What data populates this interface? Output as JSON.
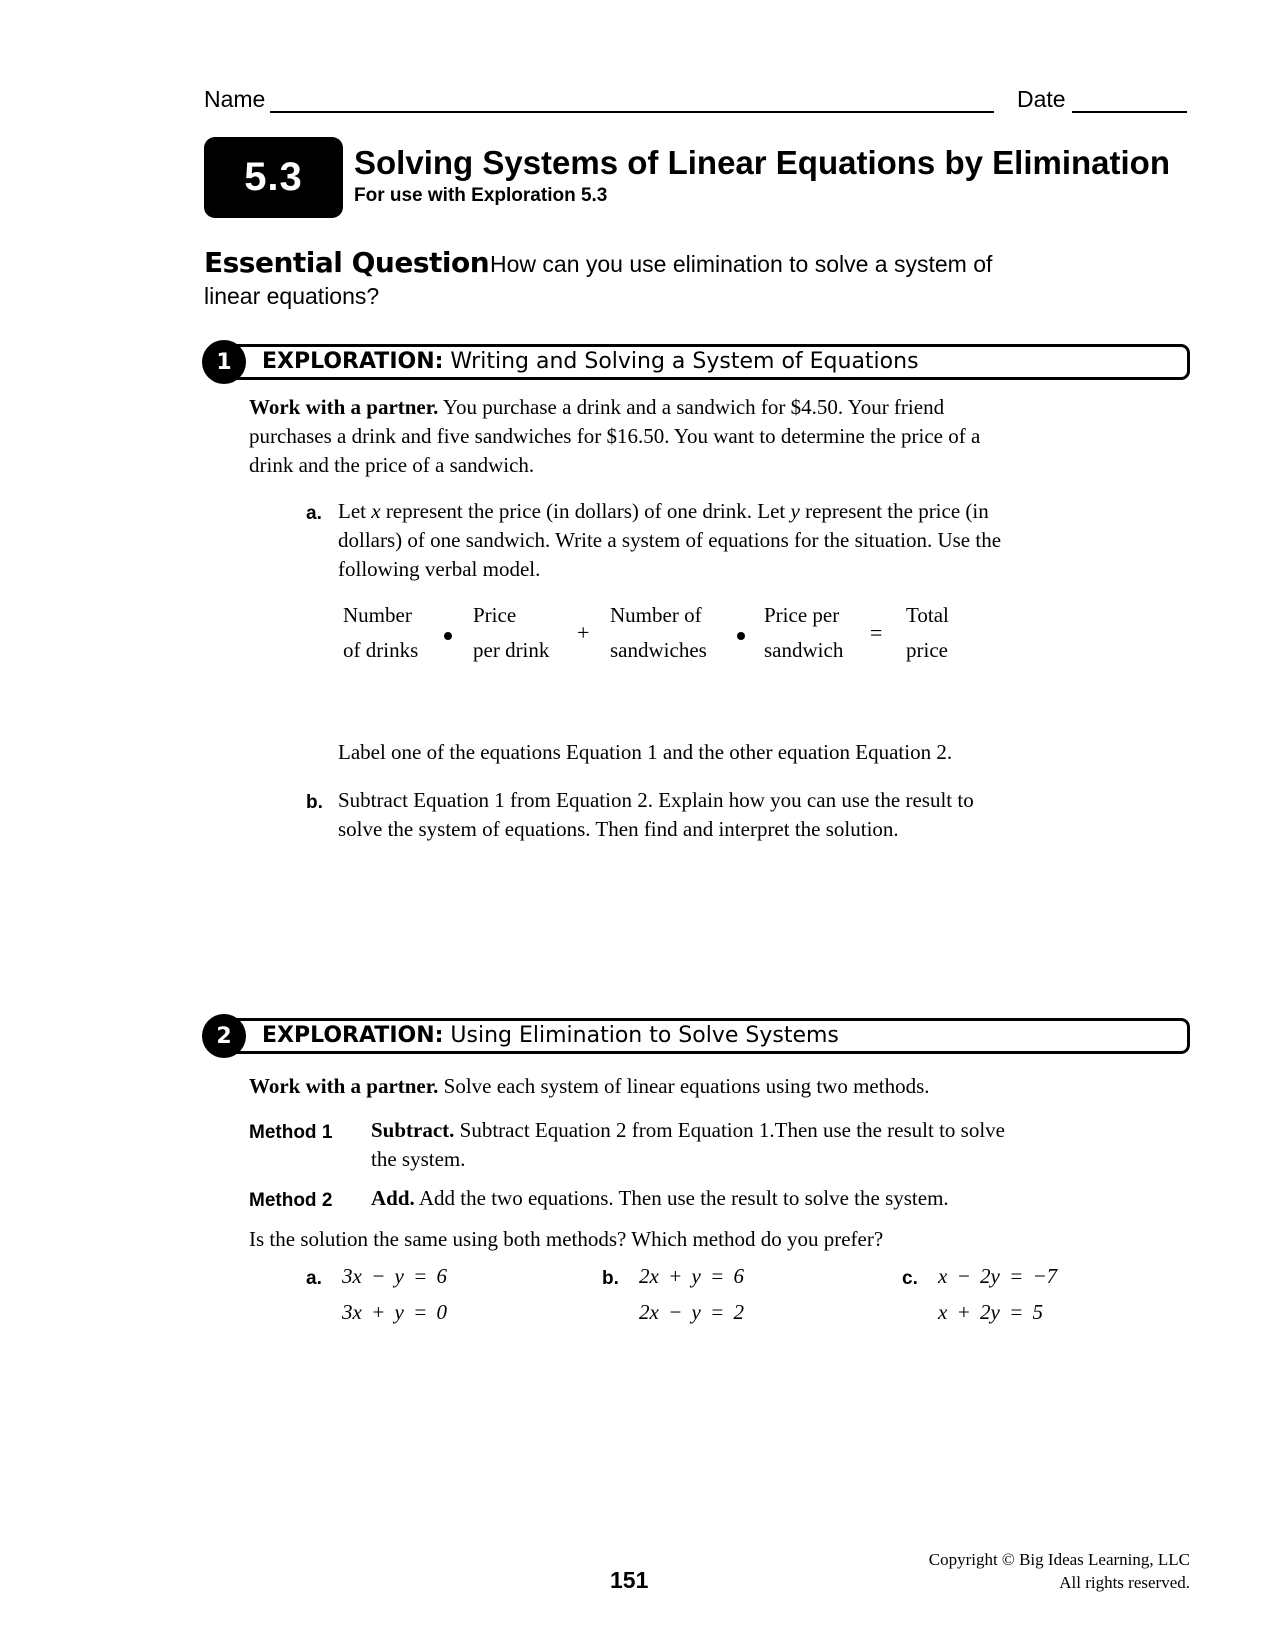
{
  "header": {
    "name_label": "Name",
    "date_label": "Date"
  },
  "lesson": {
    "number": "5.3",
    "title": "Solving Systems of Linear Equations by Elimination",
    "subtitle": "For use with Exploration 5.3"
  },
  "essential_question": {
    "label": "Essential Question",
    "text_line1": "How can you use elimination to solve a system of",
    "text_line2": "linear equations?"
  },
  "exploration1": {
    "number": "1",
    "label": "EXPLORATION:",
    "title": "Writing and Solving a System of Equations",
    "intro_bold": "Work with a partner.",
    "intro_lines": [
      " You purchase a drink and a sandwich for $4.50. Your friend",
      "purchases a drink and five sandwiches for $16.50. You want to determine the price of a",
      "drink and the price of a sandwich."
    ],
    "part_a": {
      "label": "a.",
      "line1_pre": "Let ",
      "var_x": "x",
      "line1_mid": " represent the price (in dollars) of one drink. Let ",
      "var_y": "y",
      "line1_post": " represent the price (in",
      "line2": "dollars) of one sandwich. Write a system of equations for the situation. Use the",
      "line3": "following verbal model."
    },
    "verbal_model": {
      "terms": [
        {
          "top": "Number",
          "bottom": "of drinks"
        },
        {
          "top": "Price",
          "bottom": "per drink"
        },
        {
          "top": "Number of",
          "bottom": "sandwiches"
        },
        {
          "top": "Price per",
          "bottom": "sandwich"
        },
        {
          "top": "Total",
          "bottom": "price"
        }
      ],
      "plus": "+",
      "equals": "="
    },
    "label_instruction": "Label one of the equations Equation 1 and the other equation Equation 2.",
    "part_b": {
      "label": "b.",
      "line1": "Subtract Equation 1 from Equation 2. Explain how you can use the result to",
      "line2": "solve the system of equations. Then find and interpret the solution."
    }
  },
  "exploration2": {
    "number": "2",
    "label": "EXPLORATION:",
    "title": "Using Elimination to Solve Systems",
    "intro_bold": "Work with a partner.",
    "intro_text": " Solve each system of linear equations using two methods.",
    "methods": [
      {
        "label": "Method 1",
        "bold": "Subtract.",
        "line1": " Subtract Equation 2 from Equation 1.Then use the result to solve",
        "line2": "the system."
      },
      {
        "label": "Method 2",
        "bold": "Add.",
        "line1": " Add the two equations. Then use the result to solve the system.",
        "line2": ""
      }
    ],
    "question": "Is the solution the same using both methods? Which method do you prefer?",
    "systems": [
      {
        "label": "a.",
        "eq1": "3x − y = 6",
        "eq2": "3x + y = 0"
      },
      {
        "label": "b.",
        "eq1": "2x + y = 6",
        "eq2": "2x − y = 2"
      },
      {
        "label": "c.",
        "eq1": "x − 2y = −7",
        "eq2": "x + 2y = 5"
      }
    ]
  },
  "footer": {
    "page_number": "151",
    "copyright_line1": "Copyright © Big Ideas Learning, LLC",
    "copyright_line2": "All rights reserved."
  }
}
